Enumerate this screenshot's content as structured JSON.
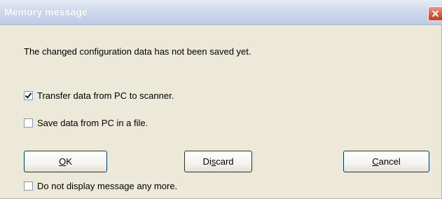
{
  "window": {
    "title": "Memory message",
    "close_icon": "close-icon"
  },
  "message": {
    "text": "The changed configuration data has not been saved yet."
  },
  "options": [
    {
      "label": "Transfer data from PC to scanner.",
      "checked": true
    },
    {
      "label": "Save data from PC in a file.",
      "checked": false
    }
  ],
  "buttons": {
    "ok": {
      "accel": "O",
      "rest": "K"
    },
    "discard": {
      "pre": "Di",
      "accel": "s",
      "rest": "card"
    },
    "cancel": {
      "accel": "C",
      "rest": "ancel"
    }
  },
  "footer_option": {
    "label": "Do not display message any more.",
    "checked": false
  },
  "colors": {
    "dialog_bg": "#ece9d8",
    "title_text": "#ffffff",
    "close_button": "#c24125",
    "button_border": "#003c74"
  }
}
